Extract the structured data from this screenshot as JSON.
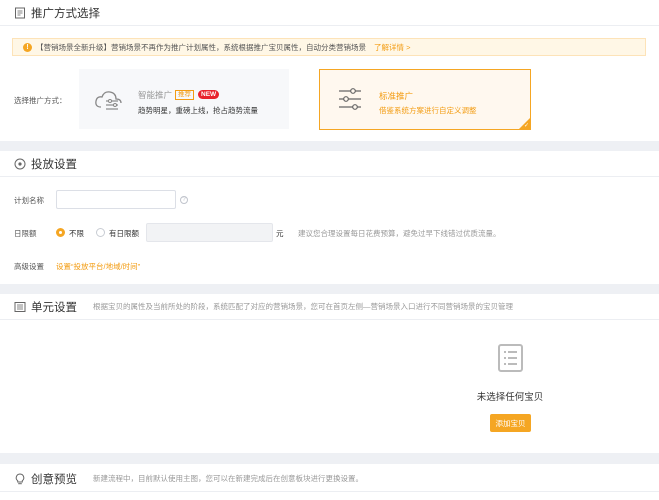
{
  "section_mode": {
    "title": "推广方式选择",
    "notice": {
      "text": "【营销场景全新升级】营销场景不再作为推广计划属性，系统根据推广宝贝属性，自动分类营销场景",
      "link": "了解详情 >"
    },
    "label": "选择推广方式：",
    "smart_card": {
      "title": "智能推广",
      "tag_recommend": "推荐",
      "tag_new": "NEW",
      "desc": "趋势明星，重磅上线，抢占趋势流量"
    },
    "standard_card": {
      "title": "标准推广",
      "desc": "借鉴系统方案进行自定义调整"
    }
  },
  "section_delivery": {
    "title": "投放设置",
    "plan_name_label": "计划名称",
    "plan_name_value": "",
    "daily_limit_label": "日限额",
    "option_unlimited": "不限",
    "option_limited": "有日限额",
    "daily_limit_value": "",
    "unit": "元",
    "hint": "建议您合理设置每日花费预算，避免过早下线错过优质流量。",
    "advanced_label": "高级设置",
    "advanced_link": "设置“投放平台/地域/时间”"
  },
  "section_unit": {
    "title": "单元设置",
    "desc": "根据宝贝的属性及当前所处的阶段，系统匹配了对应的营销场景，您可在首页左侧—营销场景入口进行不同营销场景的宝贝管理",
    "empty_text": "未选择任何宝贝",
    "add_button": "添加宝贝"
  },
  "section_creative": {
    "title": "创意预览",
    "desc": "新建流程中，目前默认使用主图，您可以在新建完成后在创意板块进行更换设置。"
  },
  "colors": {
    "accent": "#f5a623",
    "new_badge": "#e8232d",
    "page_bg": "#eef0f4"
  }
}
